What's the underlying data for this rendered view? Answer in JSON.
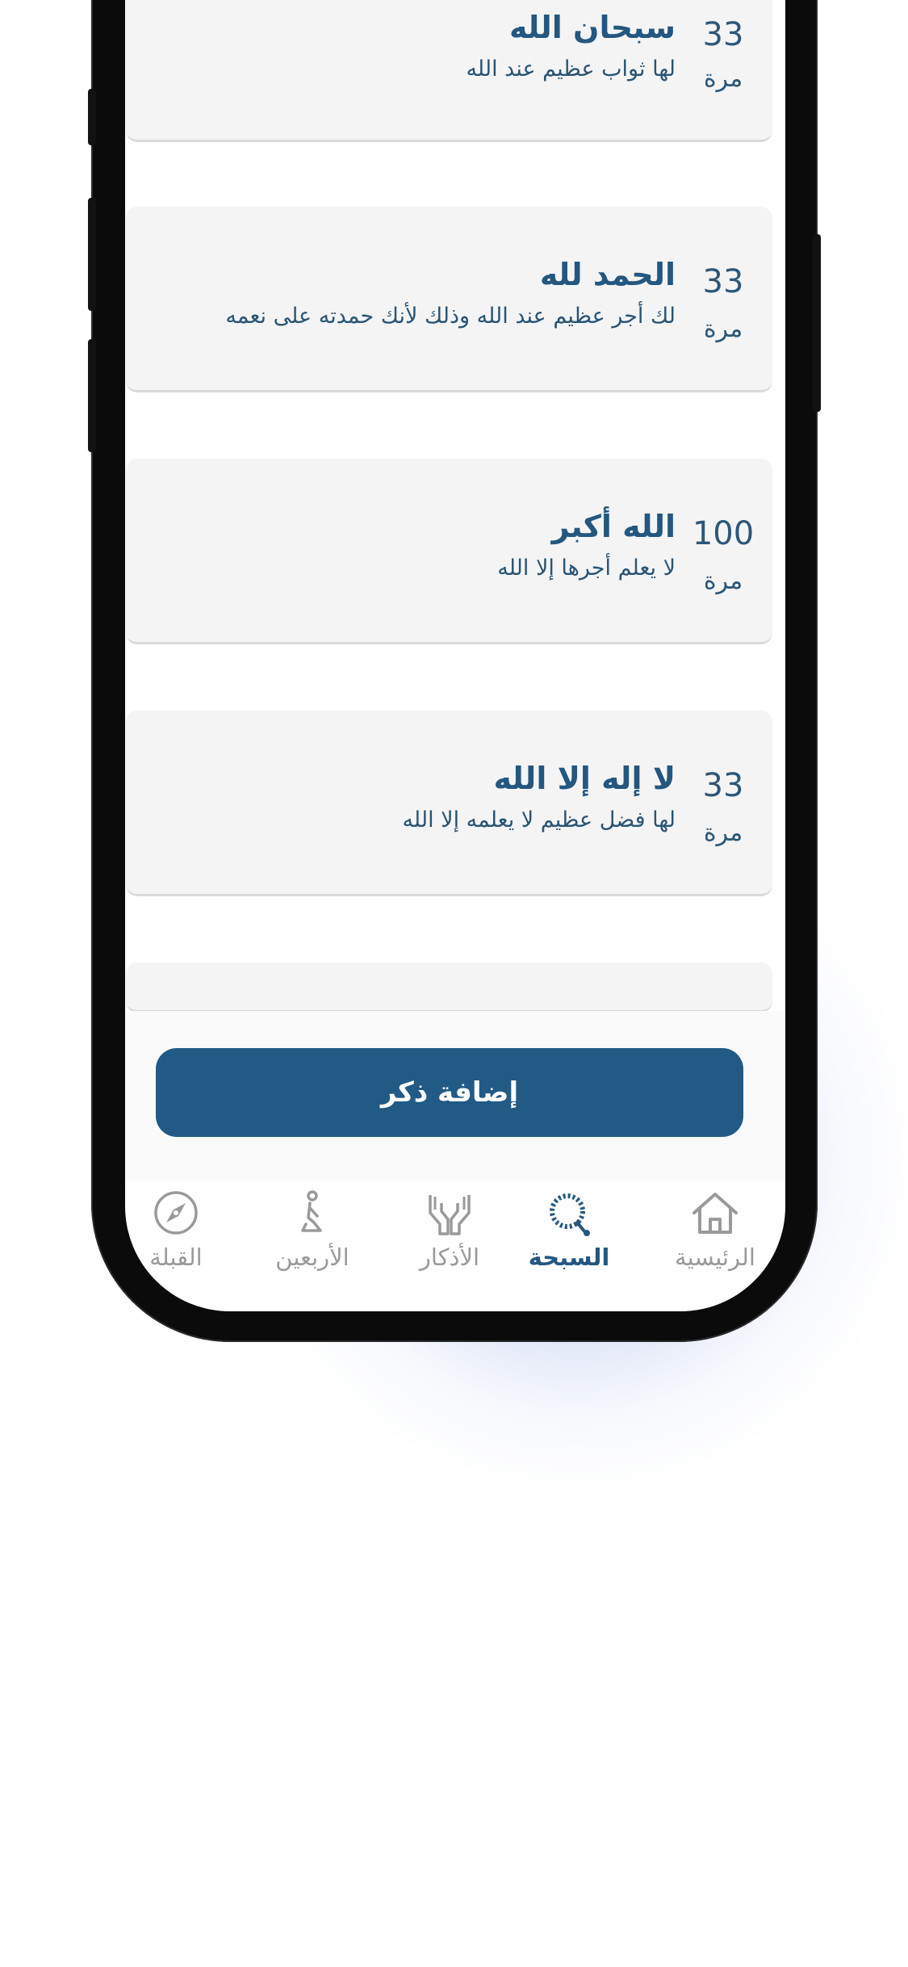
{
  "adhkar": [
    {
      "title": "سبحان الله",
      "description": "لها ثواب عظيم عند الله",
      "count": "33",
      "unit": "مرة"
    },
    {
      "title": "الحمد لله",
      "description": "لك أجر عظيم عند الله وذلك لأنك حمدته على نعمه",
      "count": "33",
      "unit": "مرة"
    },
    {
      "title": "الله أكبر",
      "description": "لا يعلم أجرها إلا الله",
      "count": "100",
      "unit": "مرة"
    },
    {
      "title": "لا إله إلا الله",
      "description": "لها فضل عظيم لا يعلمه إلا الله",
      "count": "33",
      "unit": "مرة"
    }
  ],
  "add_button": {
    "label": "إضافة ذكر"
  },
  "tabs": [
    {
      "label": "الرئيسية",
      "icon": "home-icon",
      "active": false
    },
    {
      "label": "السبحة",
      "icon": "prayer-beads-icon",
      "active": true
    },
    {
      "label": "الأذكار",
      "icon": "praying-hands-icon",
      "active": false
    },
    {
      "label": "الأربعين",
      "icon": "praying-person-icon",
      "active": false
    },
    {
      "label": "القبلة",
      "icon": "compass-icon",
      "active": false
    }
  ],
  "colors": {
    "primary": "#215a85",
    "title_text": "#24577f",
    "card_background": "#f4f4f5",
    "inactive_tab": "#9a9a9c"
  }
}
